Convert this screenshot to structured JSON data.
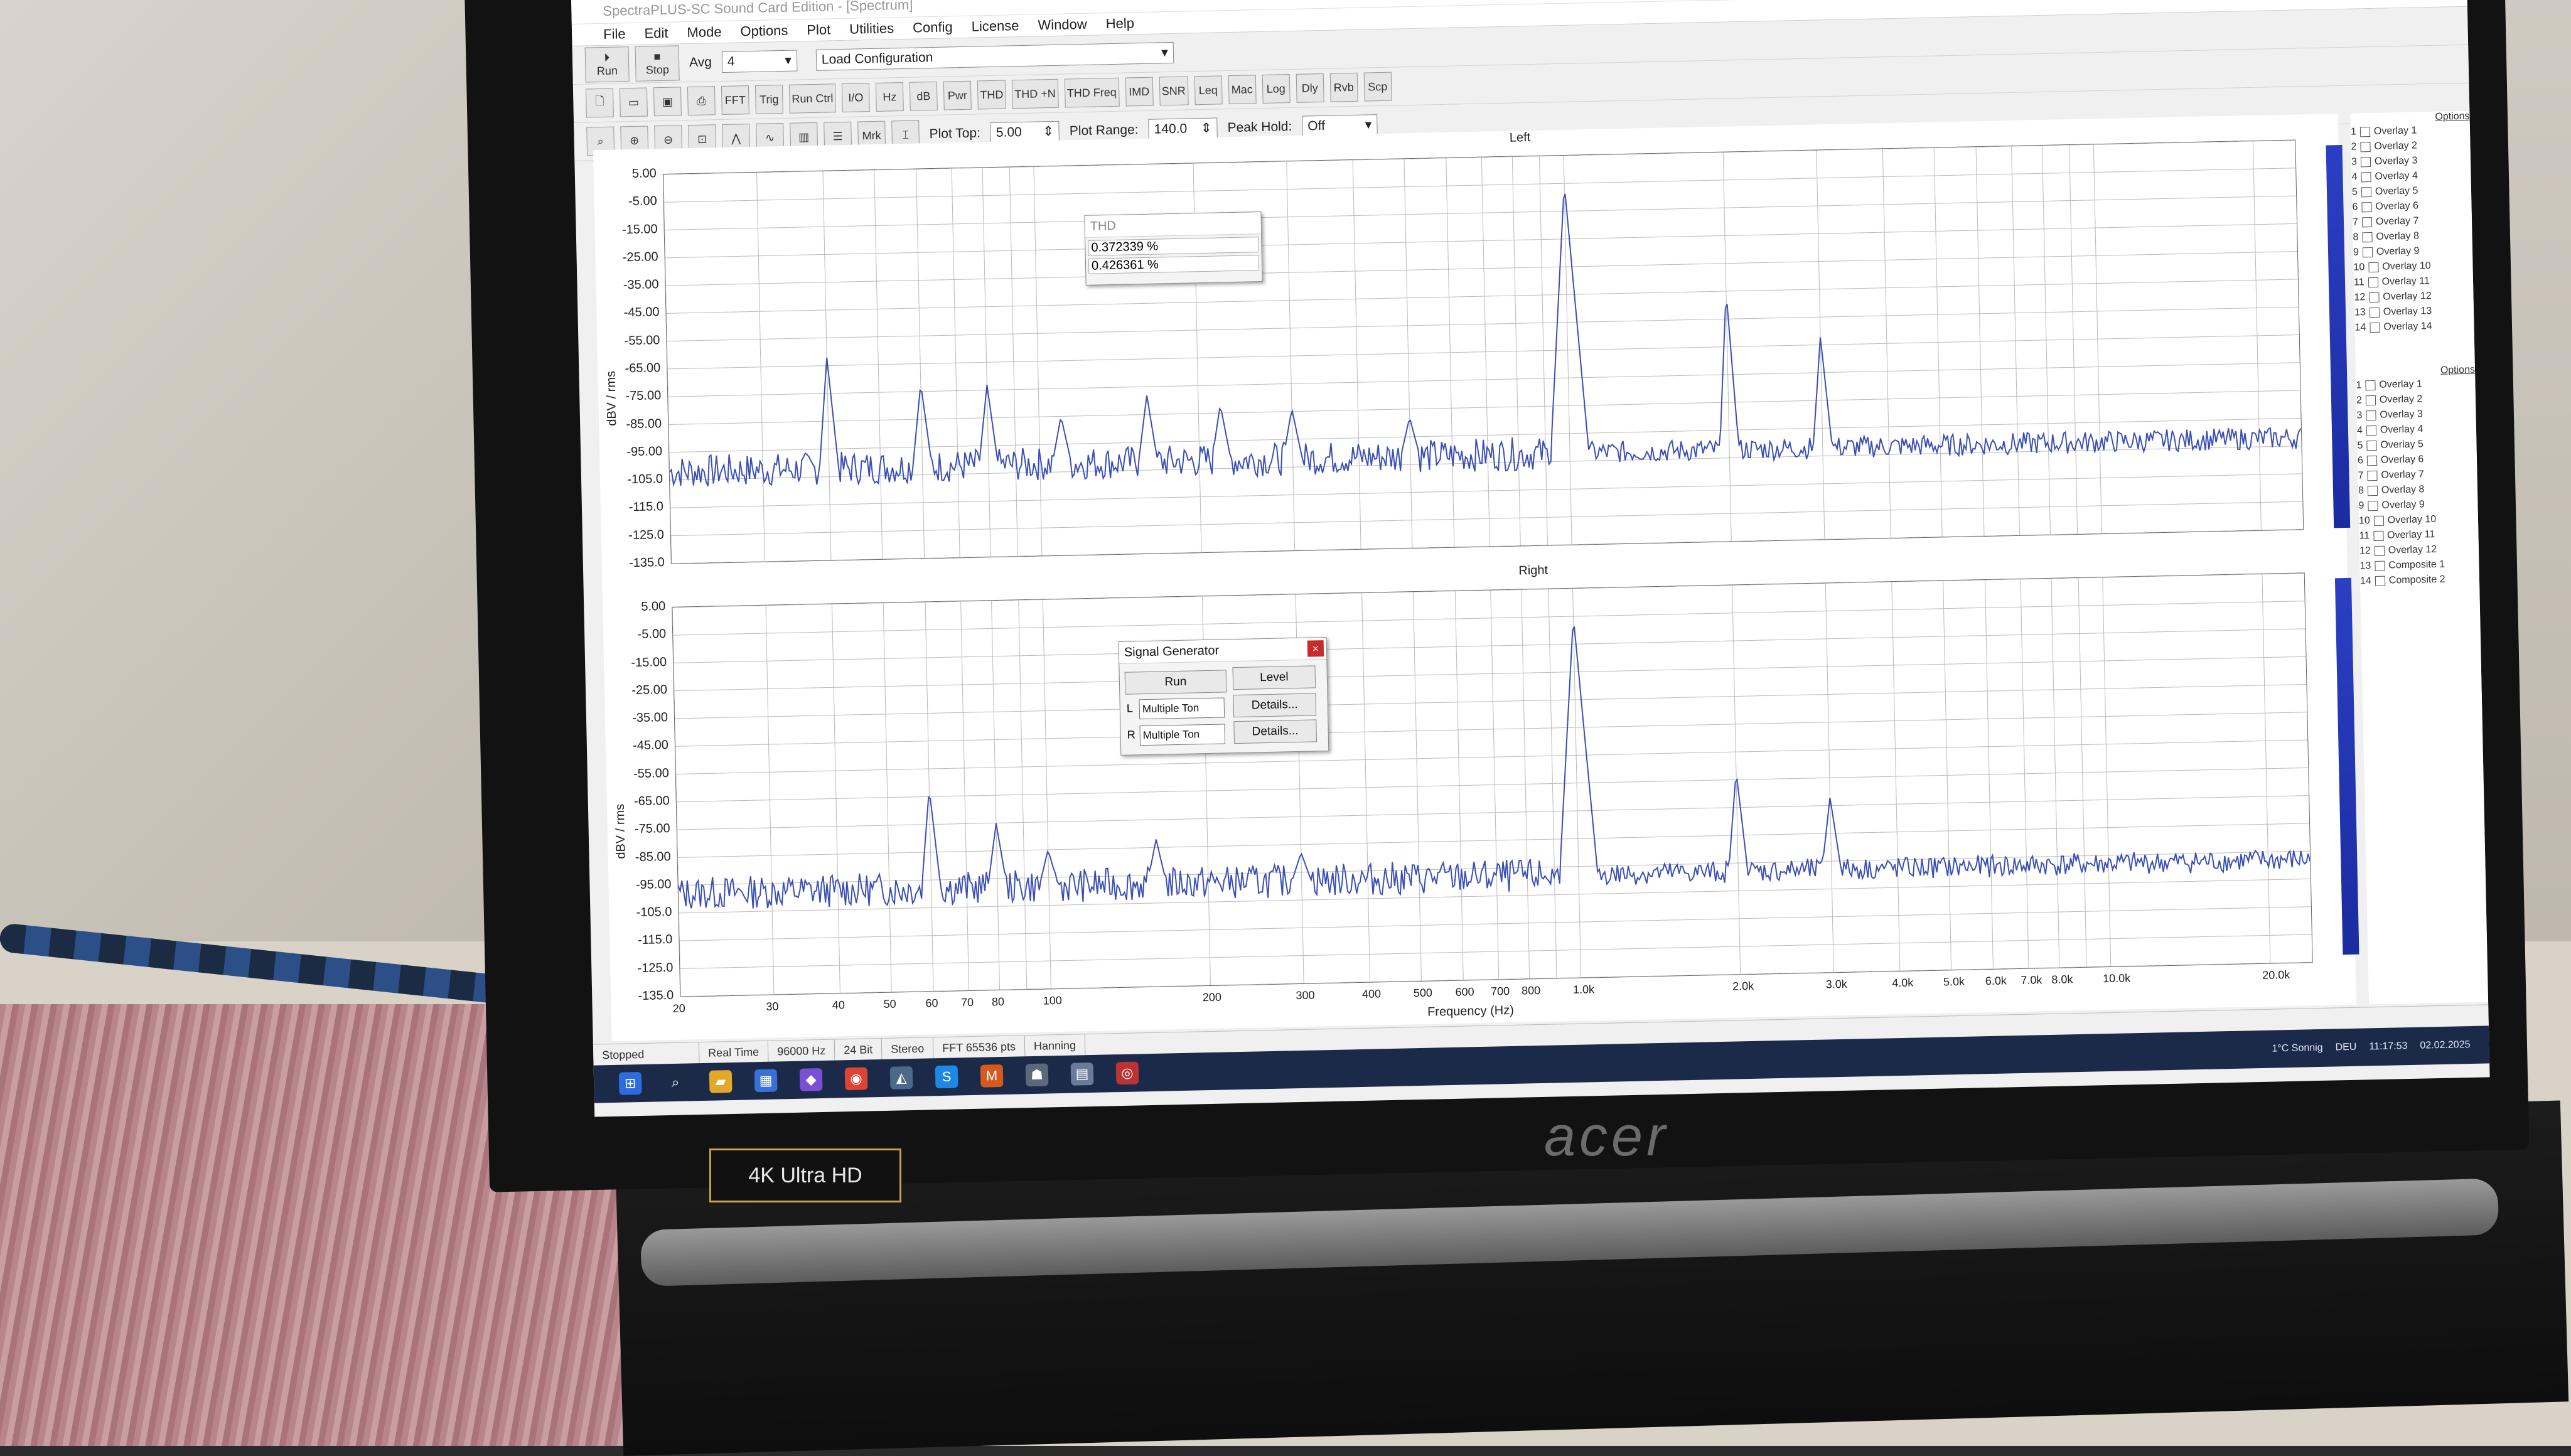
{
  "app": {
    "title": "SpectraPLUS-SC Sound Card Edition - [Spectrum]",
    "menu": [
      "File",
      "Edit",
      "Mode",
      "Options",
      "Plot",
      "Utilities",
      "Config",
      "License",
      "Window",
      "Help"
    ]
  },
  "toolbar": {
    "run_label": "Run",
    "stop_label": "Stop",
    "avg_label": "Avg",
    "avg_value": "4",
    "config_select": "Load Configuration",
    "buttons": [
      "FFT",
      "Trig",
      "Run Ctrl",
      "I/O",
      "Hz",
      "dB",
      "Pwr",
      "THD",
      "THD +N",
      "THD Freq",
      "IMD",
      "SNR",
      "Leq",
      "Mac",
      "Log",
      "Dly",
      "Rvb",
      "Scp"
    ],
    "mrk_label": "Mrk",
    "plot_top_label": "Plot Top:",
    "plot_top_value": "5.00",
    "plot_range_label": "Plot Range:",
    "plot_range_value": "140.0",
    "peak_hold_label": "Peak Hold:",
    "peak_hold_value": "Off"
  },
  "plots": {
    "left_title": "Left",
    "right_title": "Right",
    "y_axis_label": "dBV / rms",
    "x_axis_label": "Frequency (Hz)",
    "y_ticks": [
      "5.00",
      "-5.00",
      "-15.00",
      "-25.00",
      "-35.00",
      "-45.00",
      "-55.00",
      "-65.00",
      "-75.00",
      "-85.00",
      "-95.00",
      "-105.0",
      "-115.0",
      "-125.0",
      "-135.0"
    ],
    "x_ticks": [
      "20",
      "30",
      "40",
      "50",
      "60",
      "70",
      "80",
      "100",
      "200",
      "300",
      "400",
      "500",
      "600",
      "700",
      "800",
      "1.0k",
      "2.0k",
      "3.0k",
      "4.0k",
      "5.0k",
      "6.0k",
      "7.0k",
      "8.0k",
      "10.0k",
      "20.0k"
    ],
    "trace_color": "#3a4fb5"
  },
  "chart_data": [
    {
      "type": "line",
      "title": "Left",
      "ylabel": "dBV / rms",
      "ylim": [
        -135,
        5
      ],
      "xscale": "log",
      "xlim": [
        20,
        24000
      ],
      "peaks": [
        {
          "x": 40,
          "y": -62
        },
        {
          "x": 60,
          "y": -72
        },
        {
          "x": 80,
          "y": -73
        },
        {
          "x": 110,
          "y": -85
        },
        {
          "x": 160,
          "y": -78
        },
        {
          "x": 220,
          "y": -82
        },
        {
          "x": 300,
          "y": -84
        },
        {
          "x": 500,
          "y": -88
        },
        {
          "x": 1000,
          "y": -5
        },
        {
          "x": 2000,
          "y": -45
        },
        {
          "x": 3000,
          "y": -62
        }
      ],
      "noise_floor": -102
    },
    {
      "type": "line",
      "title": "Right",
      "ylabel": "dBV / rms",
      "ylim": [
        -135,
        5
      ],
      "xscale": "log",
      "xlim": [
        20,
        24000
      ],
      "peaks": [
        {
          "x": 60,
          "y": -62
        },
        {
          "x": 80,
          "y": -75
        },
        {
          "x": 100,
          "y": -85
        },
        {
          "x": 160,
          "y": -82
        },
        {
          "x": 300,
          "y": -88
        },
        {
          "x": 1000,
          "y": -5
        },
        {
          "x": 2000,
          "y": -62
        },
        {
          "x": 3000,
          "y": -72
        }
      ],
      "noise_floor": -98
    }
  ],
  "thd_dialog": {
    "title": "THD",
    "values": [
      "0.372339 %",
      "0.426361 %"
    ]
  },
  "siggen_dialog": {
    "title": "Signal Generator",
    "run_label": "Run",
    "level_label": "Level",
    "left_ch": "L",
    "right_ch": "R",
    "left_mode": "Multiple Ton",
    "right_mode": "Multiple Ton",
    "details_label": "Details..."
  },
  "overlays": {
    "options_label": "Options",
    "left_items": [
      "Overlay 1",
      "Overlay 2",
      "Overlay 3",
      "Overlay 4",
      "Overlay 5",
      "Overlay 6",
      "Overlay 7",
      "Overlay 8",
      "Overlay 9",
      "Overlay 10",
      "Overlay 11",
      "Overlay 12",
      "Overlay 13",
      "Overlay 14"
    ],
    "right_items": [
      "Overlay 1",
      "Overlay 2",
      "Overlay 3",
      "Overlay 4",
      "Overlay 5",
      "Overlay 6",
      "Overlay 7",
      "Overlay 8",
      "Overlay 9",
      "Overlay 10",
      "Overlay 11",
      "Overlay 12",
      "Composite 1",
      "Composite 2"
    ]
  },
  "status": [
    "Stopped",
    "Real Time",
    "96000 Hz",
    "24 Bit",
    "Stereo",
    "FFT 65536 pts",
    "Hanning"
  ],
  "taskbar": {
    "weather": "1°C Sonnig",
    "lang": "DEU",
    "time": "11:17:53",
    "date": "02.02.2025"
  },
  "laptop": {
    "brand": "acer",
    "badge": "4K Ultra HD"
  }
}
